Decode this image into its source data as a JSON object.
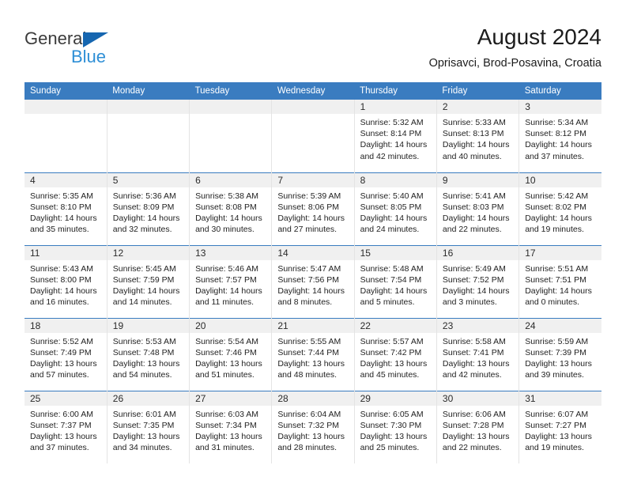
{
  "brand": {
    "name_top": "General",
    "name_bottom": "Blue",
    "triangle_color": "#1666b0",
    "blue_color": "#2e8fd6"
  },
  "header": {
    "title": "August 2024",
    "subtitle": "Oprisavci, Brod-Posavina, Croatia"
  },
  "theme": {
    "header_bg": "#3a7cc0",
    "daynum_bg": "#f0f0f0",
    "row_divider": "#3a7cc0",
    "cell_divider": "#e4e4e4"
  },
  "weekdays": [
    "Sunday",
    "Monday",
    "Tuesday",
    "Wednesday",
    "Thursday",
    "Friday",
    "Saturday"
  ],
  "labels": {
    "sunrise": "Sunrise:",
    "sunset": "Sunset:",
    "daylight": "Daylight:"
  },
  "weeks": [
    [
      {
        "day": "",
        "empty": true
      },
      {
        "day": "",
        "empty": true
      },
      {
        "day": "",
        "empty": true
      },
      {
        "day": "",
        "empty": true
      },
      {
        "day": "1",
        "sunrise": "Sunrise: 5:32 AM",
        "sunset": "Sunset: 8:14 PM",
        "daylight_1": "Daylight: 14 hours",
        "daylight_2": "and 42 minutes."
      },
      {
        "day": "2",
        "sunrise": "Sunrise: 5:33 AM",
        "sunset": "Sunset: 8:13 PM",
        "daylight_1": "Daylight: 14 hours",
        "daylight_2": "and 40 minutes."
      },
      {
        "day": "3",
        "sunrise": "Sunrise: 5:34 AM",
        "sunset": "Sunset: 8:12 PM",
        "daylight_1": "Daylight: 14 hours",
        "daylight_2": "and 37 minutes."
      }
    ],
    [
      {
        "day": "4",
        "sunrise": "Sunrise: 5:35 AM",
        "sunset": "Sunset: 8:10 PM",
        "daylight_1": "Daylight: 14 hours",
        "daylight_2": "and 35 minutes."
      },
      {
        "day": "5",
        "sunrise": "Sunrise: 5:36 AM",
        "sunset": "Sunset: 8:09 PM",
        "daylight_1": "Daylight: 14 hours",
        "daylight_2": "and 32 minutes."
      },
      {
        "day": "6",
        "sunrise": "Sunrise: 5:38 AM",
        "sunset": "Sunset: 8:08 PM",
        "daylight_1": "Daylight: 14 hours",
        "daylight_2": "and 30 minutes."
      },
      {
        "day": "7",
        "sunrise": "Sunrise: 5:39 AM",
        "sunset": "Sunset: 8:06 PM",
        "daylight_1": "Daylight: 14 hours",
        "daylight_2": "and 27 minutes."
      },
      {
        "day": "8",
        "sunrise": "Sunrise: 5:40 AM",
        "sunset": "Sunset: 8:05 PM",
        "daylight_1": "Daylight: 14 hours",
        "daylight_2": "and 24 minutes."
      },
      {
        "day": "9",
        "sunrise": "Sunrise: 5:41 AM",
        "sunset": "Sunset: 8:03 PM",
        "daylight_1": "Daylight: 14 hours",
        "daylight_2": "and 22 minutes."
      },
      {
        "day": "10",
        "sunrise": "Sunrise: 5:42 AM",
        "sunset": "Sunset: 8:02 PM",
        "daylight_1": "Daylight: 14 hours",
        "daylight_2": "and 19 minutes."
      }
    ],
    [
      {
        "day": "11",
        "sunrise": "Sunrise: 5:43 AM",
        "sunset": "Sunset: 8:00 PM",
        "daylight_1": "Daylight: 14 hours",
        "daylight_2": "and 16 minutes."
      },
      {
        "day": "12",
        "sunrise": "Sunrise: 5:45 AM",
        "sunset": "Sunset: 7:59 PM",
        "daylight_1": "Daylight: 14 hours",
        "daylight_2": "and 14 minutes."
      },
      {
        "day": "13",
        "sunrise": "Sunrise: 5:46 AM",
        "sunset": "Sunset: 7:57 PM",
        "daylight_1": "Daylight: 14 hours",
        "daylight_2": "and 11 minutes."
      },
      {
        "day": "14",
        "sunrise": "Sunrise: 5:47 AM",
        "sunset": "Sunset: 7:56 PM",
        "daylight_1": "Daylight: 14 hours",
        "daylight_2": "and 8 minutes."
      },
      {
        "day": "15",
        "sunrise": "Sunrise: 5:48 AM",
        "sunset": "Sunset: 7:54 PM",
        "daylight_1": "Daylight: 14 hours",
        "daylight_2": "and 5 minutes."
      },
      {
        "day": "16",
        "sunrise": "Sunrise: 5:49 AM",
        "sunset": "Sunset: 7:52 PM",
        "daylight_1": "Daylight: 14 hours",
        "daylight_2": "and 3 minutes."
      },
      {
        "day": "17",
        "sunrise": "Sunrise: 5:51 AM",
        "sunset": "Sunset: 7:51 PM",
        "daylight_1": "Daylight: 14 hours",
        "daylight_2": "and 0 minutes."
      }
    ],
    [
      {
        "day": "18",
        "sunrise": "Sunrise: 5:52 AM",
        "sunset": "Sunset: 7:49 PM",
        "daylight_1": "Daylight: 13 hours",
        "daylight_2": "and 57 minutes."
      },
      {
        "day": "19",
        "sunrise": "Sunrise: 5:53 AM",
        "sunset": "Sunset: 7:48 PM",
        "daylight_1": "Daylight: 13 hours",
        "daylight_2": "and 54 minutes."
      },
      {
        "day": "20",
        "sunrise": "Sunrise: 5:54 AM",
        "sunset": "Sunset: 7:46 PM",
        "daylight_1": "Daylight: 13 hours",
        "daylight_2": "and 51 minutes."
      },
      {
        "day": "21",
        "sunrise": "Sunrise: 5:55 AM",
        "sunset": "Sunset: 7:44 PM",
        "daylight_1": "Daylight: 13 hours",
        "daylight_2": "and 48 minutes."
      },
      {
        "day": "22",
        "sunrise": "Sunrise: 5:57 AM",
        "sunset": "Sunset: 7:42 PM",
        "daylight_1": "Daylight: 13 hours",
        "daylight_2": "and 45 minutes."
      },
      {
        "day": "23",
        "sunrise": "Sunrise: 5:58 AM",
        "sunset": "Sunset: 7:41 PM",
        "daylight_1": "Daylight: 13 hours",
        "daylight_2": "and 42 minutes."
      },
      {
        "day": "24",
        "sunrise": "Sunrise: 5:59 AM",
        "sunset": "Sunset: 7:39 PM",
        "daylight_1": "Daylight: 13 hours",
        "daylight_2": "and 39 minutes."
      }
    ],
    [
      {
        "day": "25",
        "sunrise": "Sunrise: 6:00 AM",
        "sunset": "Sunset: 7:37 PM",
        "daylight_1": "Daylight: 13 hours",
        "daylight_2": "and 37 minutes."
      },
      {
        "day": "26",
        "sunrise": "Sunrise: 6:01 AM",
        "sunset": "Sunset: 7:35 PM",
        "daylight_1": "Daylight: 13 hours",
        "daylight_2": "and 34 minutes."
      },
      {
        "day": "27",
        "sunrise": "Sunrise: 6:03 AM",
        "sunset": "Sunset: 7:34 PM",
        "daylight_1": "Daylight: 13 hours",
        "daylight_2": "and 31 minutes."
      },
      {
        "day": "28",
        "sunrise": "Sunrise: 6:04 AM",
        "sunset": "Sunset: 7:32 PM",
        "daylight_1": "Daylight: 13 hours",
        "daylight_2": "and 28 minutes."
      },
      {
        "day": "29",
        "sunrise": "Sunrise: 6:05 AM",
        "sunset": "Sunset: 7:30 PM",
        "daylight_1": "Daylight: 13 hours",
        "daylight_2": "and 25 minutes."
      },
      {
        "day": "30",
        "sunrise": "Sunrise: 6:06 AM",
        "sunset": "Sunset: 7:28 PM",
        "daylight_1": "Daylight: 13 hours",
        "daylight_2": "and 22 minutes."
      },
      {
        "day": "31",
        "sunrise": "Sunrise: 6:07 AM",
        "sunset": "Sunset: 7:27 PM",
        "daylight_1": "Daylight: 13 hours",
        "daylight_2": "and 19 minutes."
      }
    ]
  ]
}
